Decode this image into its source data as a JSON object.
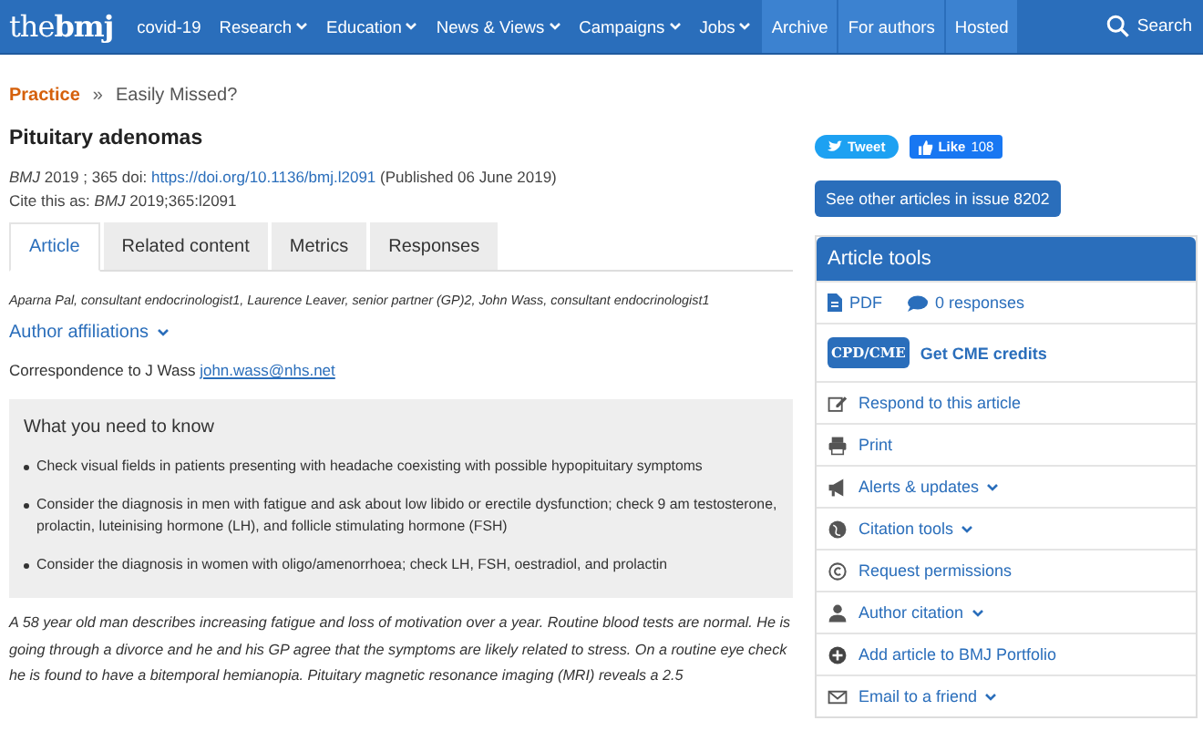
{
  "nav": {
    "logo": "the**bmj**",
    "items": [
      {
        "label": "covid-19",
        "dropdown": false,
        "highlighted": false
      },
      {
        "label": "Research",
        "dropdown": true,
        "highlighted": false
      },
      {
        "label": "Education",
        "dropdown": true,
        "highlighted": false
      },
      {
        "label": "News & Views",
        "dropdown": true,
        "highlighted": false
      },
      {
        "label": "Campaigns",
        "dropdown": true,
        "highlighted": false
      },
      {
        "label": "Jobs",
        "dropdown": true,
        "highlighted": false
      },
      {
        "label": "Archive",
        "dropdown": false,
        "highlighted": true
      },
      {
        "label": "For authors",
        "dropdown": false,
        "highlighted": true
      },
      {
        "label": "Hosted",
        "dropdown": false,
        "highlighted": true
      }
    ],
    "search": "Search"
  },
  "breadcrumb": {
    "section": "Practice",
    "separator": "»",
    "current": "Easily Missed?"
  },
  "article": {
    "title": "Pituitary adenomas",
    "meta": {
      "prefix": "*BMJ*  2019 ; 365  doi: ",
      "doi": "https://doi.org/10.1136/bmj.l2091",
      "suffix": " (Published 06 June 2019)"
    },
    "cite": "Cite this as: *BMJ*  2019;365:l2091",
    "tabs": [
      {
        "label": "Article",
        "selected": true
      },
      {
        "label": "Related content",
        "selected": false
      },
      {
        "label": "Metrics",
        "selected": false
      },
      {
        "label": "Responses",
        "selected": false
      }
    ],
    "authors": "Aparna Pal, consultant endocrinologist1,  Laurence Leaver, senior partner (GP)2,  John Wass, consultant endocrinologist1",
    "affiliations": "Author affiliations",
    "correspondence": {
      "text": "Correspondence to J Wass ",
      "email": "john.wass@nhs.net"
    },
    "box": {
      "heading": "What you need to know",
      "bullets": [
        "Check visual fields in patients presenting with headache coexisting with possible hypopituitary symptoms",
        "Consider the diagnosis in men with fatigue and ask about low libido or erectile dysfunction; check 9 am testosterone, prolactin, luteinising hormone (LH), and follicle stimulating hormone (FSH)",
        "Consider the diagnosis in women with oligo/amenorrhoea; check LH, FSH, oestradiol, and prolactin"
      ]
    },
    "body": "A 58 year old man describes increasing fatigue and loss of motivation over a year. Routine blood tests are normal. He is going through a divorce and he and his GP agree that the symptoms are likely related to stress. On a routine eye check he is found to have a bitemporal hemianopia. Pituitary magnetic resonance imaging (MRI) reveals a 2.5"
  },
  "sidebar": {
    "tweet": "Tweet",
    "like": "Like",
    "like_count": "108",
    "issue_button": "See other articles in issue 8202",
    "tools": {
      "title": "Article tools",
      "pdf": "PDF",
      "responses": "0 responses",
      "cpd_badge": "CPD/CME",
      "cme": "Get CME credits",
      "items": [
        {
          "kind": "edit",
          "label": "Respond to this article",
          "dropdown": false
        },
        {
          "kind": "print",
          "label": "Print",
          "dropdown": false
        },
        {
          "kind": "megaphone",
          "label": "Alerts & updates",
          "dropdown": true
        },
        {
          "kind": "globe",
          "label": "Citation tools",
          "dropdown": true
        },
        {
          "kind": "copyright",
          "label": "Request permissions",
          "dropdown": false
        },
        {
          "kind": "person",
          "label": "Author citation",
          "dropdown": true
        },
        {
          "kind": "plus",
          "label": "Add article to BMJ Portfolio",
          "dropdown": false
        },
        {
          "kind": "mail",
          "label": "Email to a friend",
          "dropdown": true
        }
      ]
    }
  }
}
